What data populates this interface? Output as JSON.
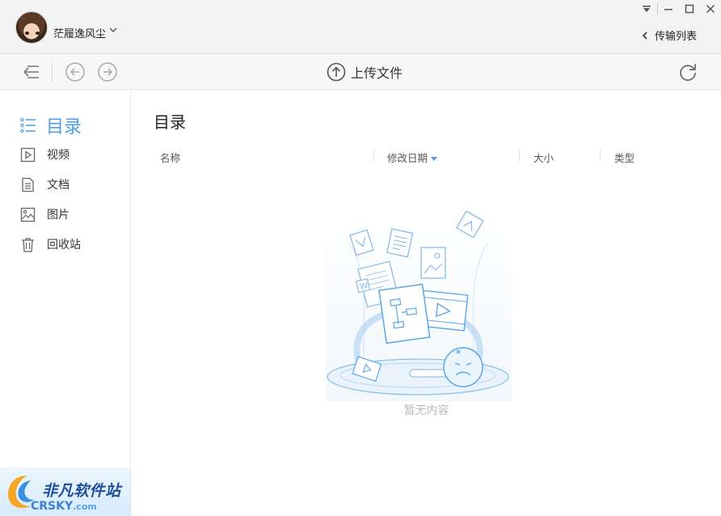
{
  "titlebar": {
    "username": "茫履逸风尘",
    "transfer_label": "传输列表"
  },
  "toolbar": {
    "upload_label": "上传文件"
  },
  "sidebar": {
    "items": [
      {
        "label": "目录",
        "icon": "list-icon",
        "active": true
      },
      {
        "label": "视频",
        "icon": "video-icon"
      },
      {
        "label": "文档",
        "icon": "document-icon"
      },
      {
        "label": "图片",
        "icon": "image-icon"
      },
      {
        "label": "回收站",
        "icon": "trash-icon"
      }
    ]
  },
  "main": {
    "title": "目录",
    "columns": [
      "名称",
      "修改日期",
      "大小",
      "类型"
    ],
    "empty_text": "暂无内容"
  },
  "watermark": {
    "cn": "非凡软件站",
    "en": "CRSKY",
    "en_suffix": ".com"
  },
  "colors": {
    "accent": "#4e9ee8",
    "titlebar_bg": "#f3f3f3",
    "toolbar_bg": "#f7f7f7"
  }
}
